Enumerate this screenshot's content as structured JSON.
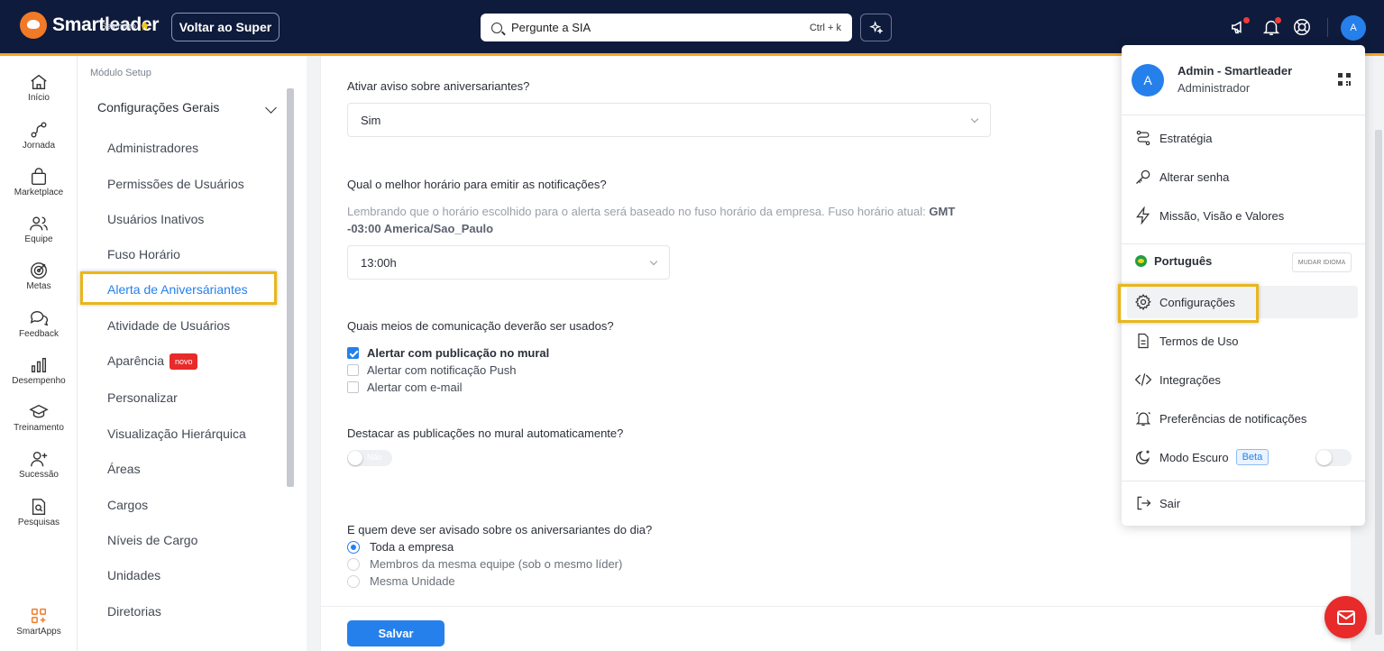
{
  "topbar": {
    "brand": "Smartleader",
    "brand_sub": "Setembro",
    "super_button": "Voltar ao Super",
    "search_placeholder": "Pergunte a SIA",
    "search_shortcut": "Ctrl + k",
    "avatar_initial": "A"
  },
  "rail": {
    "items": [
      {
        "label": "Início",
        "icon": "home-icon"
      },
      {
        "label": "Jornada",
        "icon": "route-icon"
      },
      {
        "label": "Marketplace",
        "icon": "shopping-bag-icon"
      },
      {
        "label": "Equipe",
        "icon": "team-icon"
      },
      {
        "label": "Metas",
        "icon": "target-icon"
      },
      {
        "label": "Feedback",
        "icon": "chat-icon"
      },
      {
        "label": "Desempenho",
        "icon": "bar-chart-icon"
      },
      {
        "label": "Treinamento",
        "icon": "graduation-cap-icon"
      },
      {
        "label": "Sucessão",
        "icon": "user-plus-icon"
      },
      {
        "label": "Pesquisas",
        "icon": "search-document-icon"
      }
    ],
    "apps_label": "SmartApps"
  },
  "submenu": {
    "caption": "Módulo Setup",
    "group": "Configurações Gerais",
    "items": [
      "Administradores",
      "Permissões de Usuários",
      "Usuários Inativos",
      "Fuso Horário",
      "Alerta de Aniversáriantes",
      "Atividade de Usuários",
      "Aparência",
      "Personalizar",
      "Visualização Hierárquica",
      "Áreas",
      "Cargos",
      "Níveis de Cargo",
      "Unidades",
      "Diretorias"
    ],
    "badge_new": "novo"
  },
  "form": {
    "q1": "Ativar aviso sobre aniversariantes?",
    "q1_value": "Sim",
    "q2": "Qual o melhor horário para emitir as notificações?",
    "hint_text": "Lembrando que o horário escolhido para o alerta será baseado no fuso horário da empresa. Fuso horário atual:",
    "hint_tz": "GMT -03:00 America/Sao_Paulo",
    "q2_value": "13:00h",
    "q3": "Quais meios de comunicação deverão ser usados?",
    "channels": [
      {
        "label": "Alertar com publicação no mural",
        "checked": true
      },
      {
        "label": "Alertar com notificação Push",
        "checked": false
      },
      {
        "label": "Alertar com e-mail",
        "checked": false
      }
    ],
    "q4": "Destacar as publicações no mural automaticamente?",
    "q4_toggle": "Não",
    "q5": "E quem deve ser avisado sobre os aniversariantes do dia?",
    "audience": [
      {
        "label": "Toda a empresa",
        "selected": true
      },
      {
        "label": "Membros da mesma equipe (sob o mesmo líder)",
        "selected": false
      },
      {
        "label": "Mesma Unidade",
        "selected": false
      }
    ],
    "save": "Salvar"
  },
  "dropdown": {
    "avatar_initial": "A",
    "name": "Admin - Smartleader",
    "role": "Administrador",
    "items": {
      "estrategia": "Estratégia",
      "senha": "Alterar senha",
      "missao": "Missão, Visão e Valores",
      "idioma": "Português",
      "mudar_idioma": "MUDAR IDIOMA",
      "configuracoes": "Configurações",
      "termos": "Termos de Uso",
      "integracoes": "Integrações",
      "notificacoes": "Preferências de notificações",
      "modo_escuro": "Modo Escuro",
      "beta": "Beta",
      "sair": "Sair"
    }
  },
  "colors": {
    "topbar": "#0f1b3c",
    "accent": "#f5a623",
    "primary": "#2680eb",
    "highlight": "#e9b61b",
    "danger": "#e82a2a"
  }
}
